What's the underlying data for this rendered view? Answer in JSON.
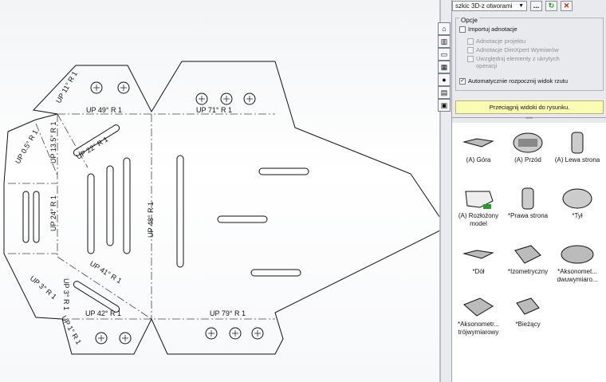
{
  "panel": {
    "view_select": "szkic 3D-z otworami",
    "more_button": "...",
    "opts_title": "Opcje",
    "options": [
      {
        "label": "Importuj adnotacje",
        "checked": false,
        "enabled": true
      },
      {
        "label": "Adnotacje projektu",
        "checked": false,
        "enabled": false
      },
      {
        "label": "Adnotacje DimXpert Wymiarów",
        "checked": false,
        "enabled": false
      },
      {
        "label": "Uwzględnij elementy z ukrytych operacji",
        "checked": false,
        "enabled": false
      },
      {
        "label": "Automatycznie rozpocznij widok rzutu",
        "checked": true,
        "enabled": true
      }
    ],
    "banner": "Przeciągnij widoki do rysunku.",
    "views": [
      {
        "label": "(A) Góra"
      },
      {
        "label": "(A) Przód"
      },
      {
        "label": "(A) Lewa strona"
      },
      {
        "label": "(A) Rozłożony model"
      },
      {
        "label": "*Prawa strona"
      },
      {
        "label": "*Tył"
      },
      {
        "label": "*Dół"
      },
      {
        "label": "*Izometryczny"
      },
      {
        "label": "*Aksonometria dwuwymiarowa"
      },
      {
        "label": "*Aksonometria trójwymiarowa"
      },
      {
        "label": "*Bieżący"
      }
    ],
    "views_display": [
      "(A) Góra",
      "(A) Przód",
      "(A) Lewa strona",
      "(A) Rozłożony model",
      "*Prawa strona",
      "*Tył",
      "*Dół",
      "*Izometryczny",
      "*Aksonomet... dwuwymiaro...",
      "*Aksonometr... trójwymiarowy",
      "*Bieżący"
    ]
  },
  "drawing": {
    "bend_notes": [
      "UP 49° R 1",
      "UP 71° R 1",
      "UP 22° R 1",
      "UP 13.5° R 1",
      "UP 0.5° R 1",
      "UP 11° R 1",
      "UP 24° R 1",
      "UP 48° R 1",
      "UP 41° R 1",
      "UP 3° R 1",
      "UP 3° R 1",
      "UP 42° R 1",
      "UP 79° R 1",
      "UP 1° R 1"
    ]
  }
}
